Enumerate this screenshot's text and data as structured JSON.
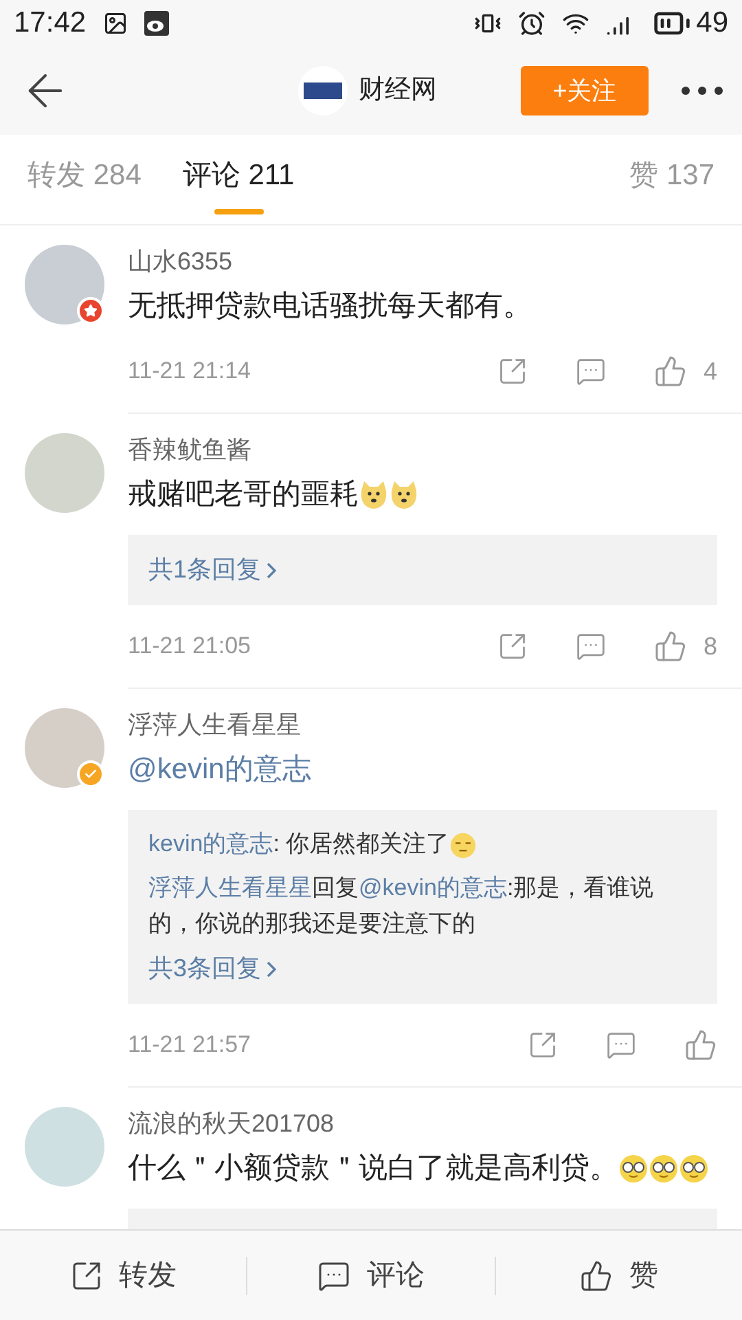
{
  "status_bar": {
    "time": "17:42",
    "battery": "49"
  },
  "header": {
    "title": "财经网",
    "follow_button": "+关注"
  },
  "tabs": [
    {
      "label": "转发 284",
      "selected": false
    },
    {
      "label": "评论 211",
      "selected": true
    },
    {
      "label": "赞 137",
      "selected": false
    }
  ],
  "comments": [
    {
      "user": "山水6355",
      "badge": {
        "kind": "star"
      },
      "text": [
        {
          "kind": "text",
          "text": "无抵押贷款电话骚扰每天都有。"
        }
      ],
      "time": "11-21 21:14",
      "likes": "4"
    },
    {
      "user": "香辣鱿鱼酱",
      "text": [
        {
          "kind": "text",
          "text": "戒赌吧老哥的噩耗"
        }
      ],
      "emojis": [
        {
          "kind": "doge"
        },
        {
          "kind": "doge"
        }
      ],
      "replies": {
        "more": "共1条回复"
      },
      "time": "11-21 21:05",
      "likes": "8"
    },
    {
      "user": "浮萍人生看星星",
      "badge": {
        "kind": "verified"
      },
      "text": [
        {
          "kind": "link",
          "text": "@kevin的意志"
        }
      ],
      "replies": {
        "lines": [
          {
            "segments": [
              {
                "kind": "link",
                "text": "kevin的意志"
              },
              {
                "kind": "text",
                "text": ": 你居然都关注了"
              }
            ],
            "emoji": {
              "kind": "shy"
            }
          },
          {
            "segments": [
              {
                "kind": "link",
                "text": "浮萍人生看星星"
              },
              {
                "kind": "text",
                "text": "回复"
              },
              {
                "kind": "link",
                "text": "@kevin的意志"
              },
              {
                "kind": "text",
                "text": ":那是，看谁说的，你说的那我还是要注意下的"
              }
            ]
          }
        ],
        "more": "共3条回复"
      },
      "time": "11-21 21:57"
    },
    {
      "user": "流浪的秋天201708",
      "text": [
        {
          "kind": "text",
          "text": "什么＂小额贷款＂说白了就是高利贷。"
        }
      ],
      "emojis": [
        {
          "kind": "glasses"
        },
        {
          "kind": "glasses"
        },
        {
          "kind": "glasses"
        }
      ],
      "cut_reply_box": true
    }
  ],
  "bottom_bar": [
    {
      "kind": "share",
      "label": "转发"
    },
    {
      "kind": "comment",
      "label": "评论"
    },
    {
      "kind": "like",
      "label": "赞"
    }
  ]
}
